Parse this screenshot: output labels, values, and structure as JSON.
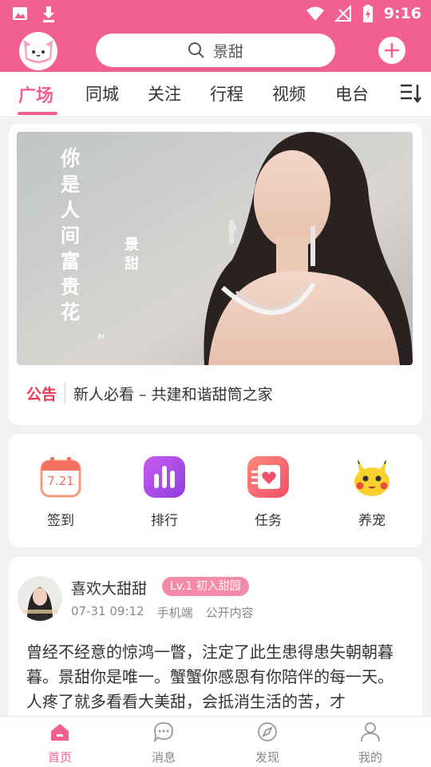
{
  "status_bar": {
    "time": "9:16"
  },
  "search": {
    "text": "景甜"
  },
  "tabs": [
    {
      "label": "广场",
      "active": true
    },
    {
      "label": "同城"
    },
    {
      "label": "关注"
    },
    {
      "label": "行程"
    },
    {
      "label": "视频"
    },
    {
      "label": "电台"
    }
  ],
  "banner": {
    "quote": "你是人间富贵花",
    "name": "景甜"
  },
  "notice": {
    "tag": "公告",
    "text": "新人必看 – 共建和谐甜筒之家"
  },
  "quick_actions": [
    {
      "label": "签到",
      "icon": "calendar-icon",
      "badge": "7.21"
    },
    {
      "label": "排行",
      "icon": "bar-chart-icon"
    },
    {
      "label": "任务",
      "icon": "task-heart-icon"
    },
    {
      "label": "养宠",
      "icon": "pet-icon"
    }
  ],
  "post": {
    "user": "喜欢大甜甜",
    "level": "Lv.1 初入甜园",
    "date": "07-31 09:12",
    "device": "手机端",
    "visibility": "公开内容",
    "body": "曾经不经意的惊鸿一瞥，注定了此生患得患失朝朝暮暮。景甜你是唯一。蟹蟹你感恩有你陪伴的每一天。人疼了就多看看大美甜，会抵消生活的苦，才"
  },
  "bottom_nav": [
    {
      "label": "首页",
      "icon": "home-icon",
      "active": true
    },
    {
      "label": "消息",
      "icon": "message-icon"
    },
    {
      "label": "发现",
      "icon": "compass-icon"
    },
    {
      "label": "我的",
      "icon": "profile-icon"
    }
  ],
  "colors": {
    "accent": "#f2608f",
    "notice": "#e8384f"
  }
}
